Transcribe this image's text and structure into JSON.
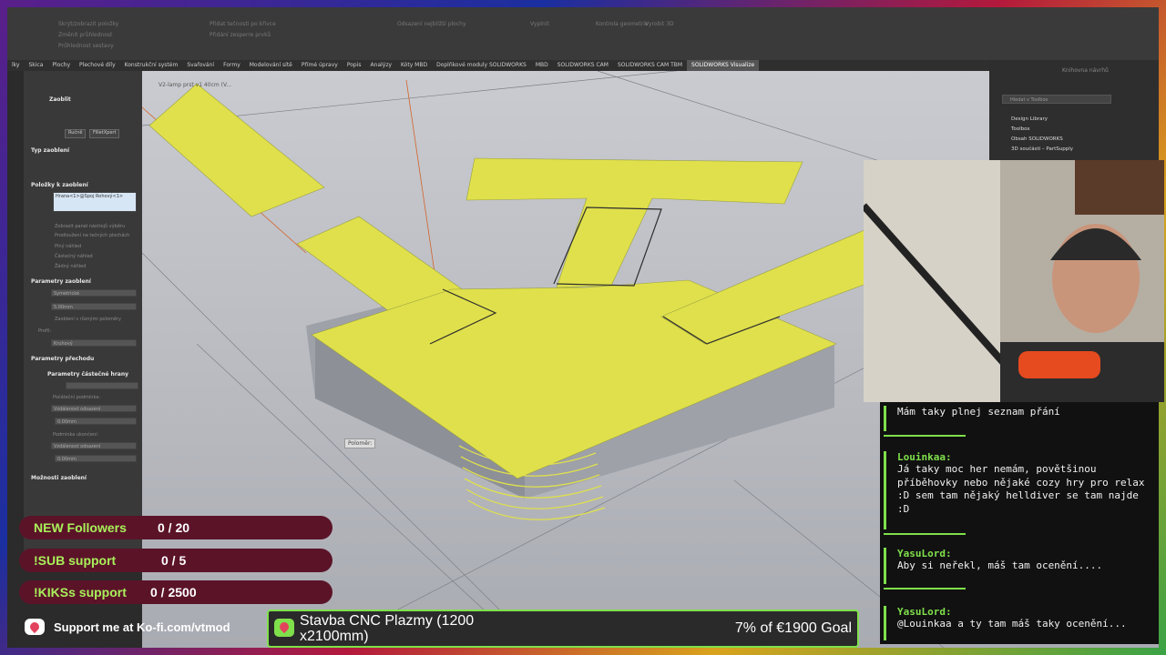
{
  "ribbon": {
    "groups": [
      "Skrýt/zobrazit položky",
      "Změnit průhlednost",
      "Průhlednost sestavy",
      "Přidat tečnosti po křivce",
      "Přidání zesperre prvků",
      "Odsazení nejbližší plochy",
      "Vyplnit",
      "Kontrola geometrie",
      "Vyrobit 3D"
    ]
  },
  "tabs": [
    "lky",
    "Skica",
    "Plochy",
    "Plechové díly",
    "Konstrukční systém",
    "Svařování",
    "Formy",
    "Modelování sítě",
    "Přímé úpravy",
    "Popis",
    "Analýzy",
    "Kóty MBD",
    "Doplňkové moduly SOLIDWORKS",
    "MBD",
    "SOLIDWORKS CAM",
    "SOLIDWORKS CAM TBM",
    "SOLIDWORKS Visualize"
  ],
  "active_tab_index": 16,
  "panel": {
    "feature": "Zaoblit",
    "mode_manual": "Ručně",
    "mode_filletxpert": "FilletXpert",
    "section_type": "Typ zaoblení",
    "section_items": "Položky k zaoblení",
    "item_value": "Hrana<1>@Spoj Rohový<1>",
    "opt1": "Zobrazit panel nástrojů výběru",
    "opt2": "Prodloužení na tečných plochách",
    "opt3": "Plný náhled",
    "opt4": "Částečný náhled",
    "opt5": "Žádný náhled",
    "section_params": "Parametry zaoblení",
    "param_type": "Symetrické",
    "param_radius": "5.00mm",
    "param_check": "Zaoblení s různými poloměry",
    "param_profile_label": "Profil:",
    "param_profile": "Kruhový",
    "section_transition": "Parametry přechodu",
    "section_partial": "Parametry částečné hrany",
    "partial_start_label": "Počáteční podmínka:",
    "partial_start": "Vzdálenost odsazení",
    "partial_start_val": "0.00mm",
    "partial_end_label": "Podmínka ukončení:",
    "partial_end": "Vzdálenost odsazení",
    "partial_end_val": "0.00mm",
    "section_options": "Možnosti zaoblení"
  },
  "viewport": {
    "tree_label": "V2-lamp prst v1 40cm (V...",
    "tooltip": "Poloměr:"
  },
  "taskpane": {
    "title": "Knihovna návrhů",
    "search_placeholder": "Hledat v Toolbox",
    "items": [
      "Design Library",
      "Toolbox",
      "Obsah SOLIDWORKS",
      "3D součásti – PartSupply"
    ]
  },
  "chat": [
    {
      "user": "",
      "text": "Mám taky plnej seznam přání"
    },
    {
      "user": "Louinkaa:",
      "text": "Já taky moc her nemám, povětšinou příběhovky nebo nějaké cozy hry pro relax :D sem tam nějaký helldiver se tam najde :D"
    },
    {
      "user": "YasuLord:",
      "text": "Aby si neřekl, máš tam ocenění...."
    },
    {
      "user": "YasuLord:",
      "text": "@Louinkaa a ty tam máš taky ocenění..."
    }
  ],
  "goals": [
    {
      "name": "NEW Followers",
      "value": "0 / 20"
    },
    {
      "name": "!SUB support",
      "value": "0 / 5"
    },
    {
      "name": "!KIKSs support",
      "value": "0 / 2500"
    }
  ],
  "kofi": {
    "text": "Support me at Ko-fi.com/vtmod"
  },
  "goal_bar": {
    "title": "Stavba CNC Plazmy (1200 x2100mm)",
    "progress": "7% of €1900 Goal",
    "progress_fraction": 0.07
  },
  "colors": {
    "accent": "#7fe04b",
    "model_yellow": "#e0e04c",
    "goal_bg": "#5b1328"
  }
}
